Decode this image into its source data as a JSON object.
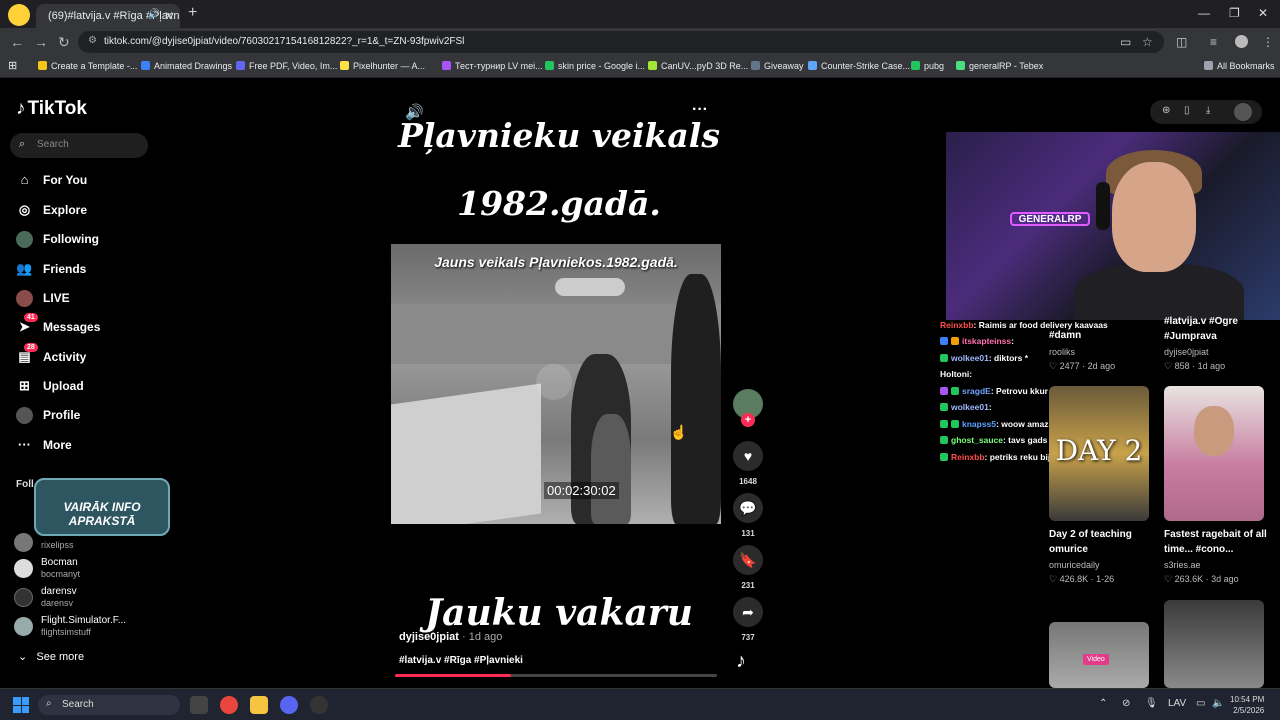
{
  "browser": {
    "tab_title": "(69)#latvija.v #Rīga #Pļavni",
    "url": "tiktok.com/@dyjise0jpiat/video/7603021715416812822?_r=1&_t=ZN-93fpwiv2FSl",
    "bookmarks": [
      "Create a Template -...",
      "Animated Drawings",
      "Free PDF, Video, Im...",
      "Pixelhunter — A...",
      "Тест-турнир LV mei...",
      "skin price - Google i...",
      "CanUV...pyD 3D Re...",
      "Giveaway",
      "Counter-Strike Case...",
      "pubg",
      "generalRP - Tebex"
    ],
    "all_bookmarks": "All Bookmarks"
  },
  "tiktok": {
    "logo": "TikTok",
    "search_placeholder": "Search",
    "nav": [
      {
        "label": "For You"
      },
      {
        "label": "Explore"
      },
      {
        "label": "Following"
      },
      {
        "label": "Friends"
      },
      {
        "label": "LIVE"
      },
      {
        "label": "Messages",
        "badge": "41"
      },
      {
        "label": "Activity",
        "badge": "28"
      },
      {
        "label": "Upload"
      },
      {
        "label": "Profile"
      },
      {
        "label": "More"
      }
    ],
    "following_header": "Foll",
    "promo_text": "VAIRĀK INFO APRAKSTĀ",
    "accounts": [
      {
        "name": "",
        "handle": "rixelipss"
      },
      {
        "name": "Bocman",
        "handle": "bocmanyt"
      },
      {
        "name": "darensv",
        "handle": "darensv"
      },
      {
        "name": "Flight.Simulator.F...",
        "handle": "flightsimstuff"
      }
    ],
    "see_more": "See more"
  },
  "video": {
    "title_line1": "Pļavnieku veikals",
    "title_line2": "1982.gadā.",
    "caption_in_still": "Jauns veikals Pļavniekos.1982.gadā.",
    "timecode": "00:02:30:02",
    "bottom_text": "Jauku vakaru",
    "author": "dyjise0jpiat",
    "posted": " · 1d ago",
    "tags": "#latvija.v #Rīga #Pļavnieki",
    "progress": 0.36,
    "likes": "1648",
    "comments": "131",
    "saves": "231",
    "shares": "737"
  },
  "chat": [
    {
      "user": "Reinxbb",
      "msg": ": Raimis ar food delivery kaavaas",
      "color": "#ff4d4d"
    },
    {
      "user": "itskapteinss",
      "msg": ":",
      "color": "#ff6fb0"
    },
    {
      "user": "wolkee01",
      "msg": ": diktors *",
      "color": "#9fb8ff"
    },
    {
      "user": "Holtoni",
      "msg": ":",
      "color": "#ffffff"
    },
    {
      "user": "sragdE",
      "msg": ": Petrovu kkur nevares redzet?",
      "color": "#6fa3ff"
    },
    {
      "user": "wolkee01",
      "msg": ":",
      "color": "#9fb8ff"
    },
    {
      "user": "knapss5",
      "msg": ": woow amazing",
      "color": "#5aa0ff"
    },
    {
      "user": "ghost_sauce",
      "msg": ": tavs gads",
      "color": "#7dff7d"
    },
    {
      "user": "Reinxbb",
      "msg": ": petriks reku bija",
      "color": "#ff4d4d"
    }
  ],
  "cards": [
    {
      "title": "#damn",
      "author": "rooliks",
      "meta": "♡ 2477 · 2d ago"
    },
    {
      "title": "#latvija.v #Ogre #Jumprava",
      "author": "dyjise0jpiat",
      "meta": "♡ 858 · 1d ago"
    },
    {
      "title": "Day 2 of teaching omurice",
      "author": "omuricedaily",
      "meta": "♡ 426.8K · 1-26",
      "overlay": "DAY 2"
    },
    {
      "title": "Fastest ragebait of all time... #cono...",
      "author": "s3ries.ae",
      "meta": "♡ 263.6K · 3d ago"
    }
  ],
  "card_video_badge": "Video",
  "stream": {
    "neon_text": "GENERALRP"
  },
  "taskbar": {
    "search": "Search",
    "lang": "LAV",
    "time": "10:54 PM",
    "date": "2/5/2026"
  },
  "colors": {
    "accent": "#fe2c55"
  }
}
